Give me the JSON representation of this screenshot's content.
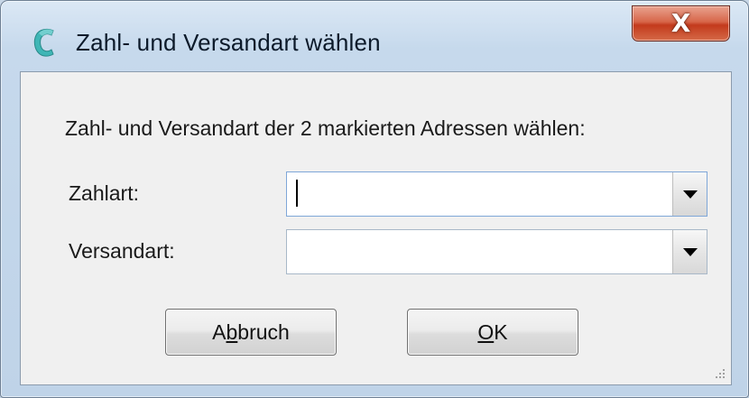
{
  "window": {
    "title": "Zahl- und Versandart wählen",
    "close_label": "X"
  },
  "dialog": {
    "prompt": "Zahl- und Versandart der 2 markierten Adressen wählen:",
    "fields": [
      {
        "label": "Zahlart:",
        "value": ""
      },
      {
        "label": "Versandart:",
        "value": ""
      }
    ],
    "buttons": {
      "cancel": {
        "pre": "A",
        "mnemonic": "b",
        "post": "bruch"
      },
      "ok": {
        "pre": "",
        "mnemonic": "O",
        "post": "K"
      }
    }
  },
  "colors": {
    "title_bar": "#c6d9ec",
    "close_button": "#c33a1c",
    "client_bg": "#f0f0f0",
    "app_icon": "#3fb6b6"
  },
  "icons": {
    "app": "app-logo-c-icon",
    "close": "close-icon",
    "dropdown": "chevron-down-icon",
    "resize": "resize-grip-icon"
  }
}
